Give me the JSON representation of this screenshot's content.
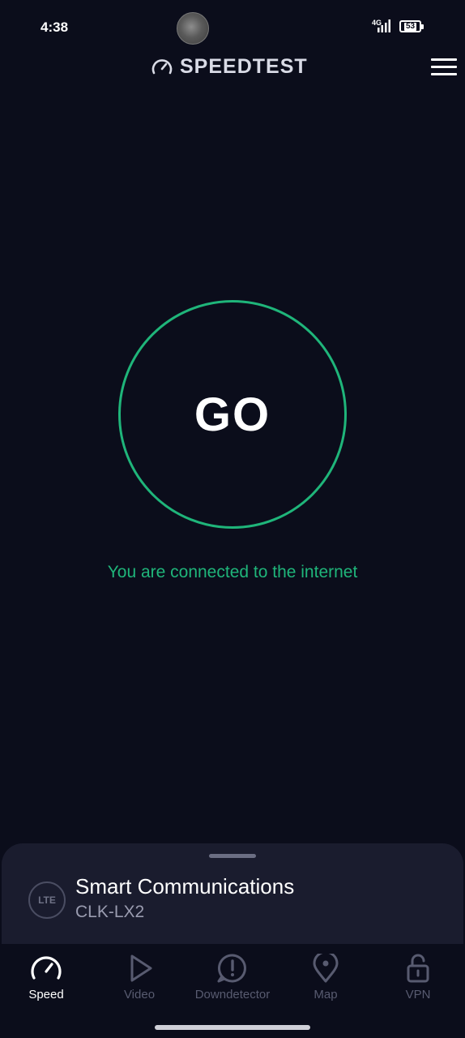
{
  "status_bar": {
    "time": "4:38",
    "network_type": "4G",
    "battery_level": "53"
  },
  "header": {
    "title": "SPEEDTEST",
    "logo_icon": "speedometer-icon",
    "menu_icon": "hamburger-menu-icon"
  },
  "main": {
    "go_label": "GO",
    "connection_status": "You are connected to the internet",
    "accent_color": "#1fb57a"
  },
  "provider": {
    "connection_type": "LTE",
    "name": "Smart Communications",
    "server": "CLK-LX2"
  },
  "tabs": [
    {
      "label": "Speed",
      "icon": "speed-gauge-icon",
      "active": true
    },
    {
      "label": "Video",
      "icon": "play-icon",
      "active": false
    },
    {
      "label": "Downdetector",
      "icon": "alert-icon",
      "active": false
    },
    {
      "label": "Map",
      "icon": "map-pin-icon",
      "active": false
    },
    {
      "label": "VPN",
      "icon": "unlock-icon",
      "active": false
    }
  ]
}
